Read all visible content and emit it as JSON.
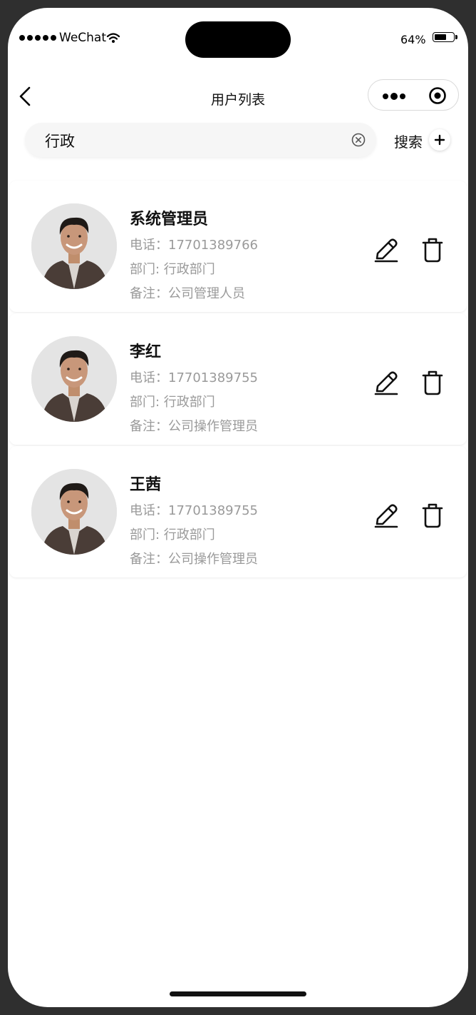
{
  "status_bar": {
    "carrier": "WeChat",
    "battery_percent_label": "64%",
    "battery_level": 0.64
  },
  "nav": {
    "title": "用户列表",
    "back_icon": "chevron-left-icon",
    "more_icon": "more-dots-icon",
    "close_icon": "target-circle-icon"
  },
  "search": {
    "value": "行政",
    "button_label": "搜索",
    "clear_icon": "clear-circle-icon",
    "add_icon": "plus-icon"
  },
  "users": [
    {
      "name": "系统管理员",
      "phone_label": "电话：",
      "phone": "17701389766",
      "dept_label": "部门: ",
      "dept": "行政部门",
      "note_label": "备注：",
      "note": "公司管理人员"
    },
    {
      "name": "李红",
      "phone_label": "电话：",
      "phone": "17701389755",
      "dept_label": "部门: ",
      "dept": "行政部门",
      "note_label": "备注：",
      "note": "公司操作管理员"
    },
    {
      "name": "王茜",
      "phone_label": "电话：",
      "phone": "17701389755",
      "dept_label": "部门: ",
      "dept": "行政部门",
      "note_label": "备注：",
      "note": "公司操作管理员"
    }
  ],
  "colors": {
    "text_primary": "#111111",
    "text_secondary": "#9a9a9a",
    "search_bg": "#f6f6f6",
    "frame": "#2f2f2f"
  }
}
